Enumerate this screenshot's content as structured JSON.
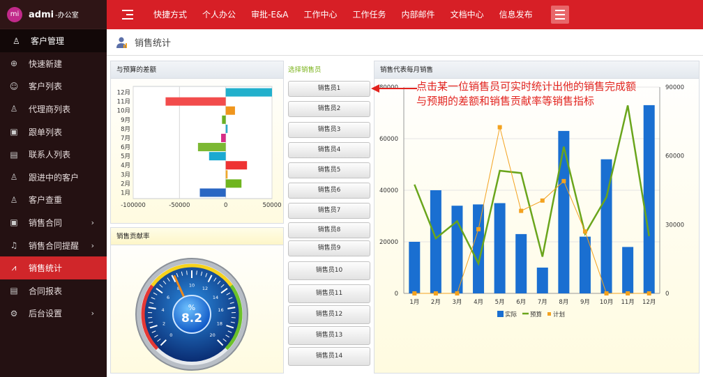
{
  "brand": {
    "avatar": "mi",
    "name": "admi",
    "dept": "-办公室"
  },
  "sidebar": {
    "header": "客户管理",
    "items": [
      {
        "label": "快速新建",
        "icon": "plus-circle-icon",
        "glyph": "⊕",
        "arrow": ""
      },
      {
        "label": "客户列表",
        "icon": "user-icon",
        "glyph": "☺",
        "arrow": ""
      },
      {
        "label": "代理商列表",
        "icon": "users-icon",
        "glyph": "♙",
        "arrow": ""
      },
      {
        "label": "跟单列表",
        "icon": "clipboard-icon",
        "glyph": "▣",
        "arrow": ""
      },
      {
        "label": "联系人列表",
        "icon": "contact-card-icon",
        "glyph": "▤",
        "arrow": ""
      },
      {
        "label": "跟进中的客户",
        "icon": "person-icon",
        "glyph": "♙",
        "arrow": ""
      },
      {
        "label": "客户查重",
        "icon": "person-icon",
        "glyph": "♙",
        "arrow": ""
      },
      {
        "label": "销售合同",
        "icon": "contract-icon",
        "glyph": "▣",
        "arrow": "›"
      },
      {
        "label": "销售合同提醒",
        "icon": "bell-icon",
        "glyph": "♫",
        "arrow": "›"
      },
      {
        "label": "销售统计",
        "icon": "line-chart-icon",
        "glyph": "⩘",
        "arrow": ""
      },
      {
        "label": "合同报表",
        "icon": "report-icon",
        "glyph": "▤",
        "arrow": ""
      },
      {
        "label": "后台设置",
        "icon": "gear-icon",
        "glyph": "⚙",
        "arrow": "›"
      }
    ]
  },
  "topnav": [
    "快捷方式",
    "个人办公",
    "审批-E&A",
    "工作中心",
    "工作任务",
    "内部邮件",
    "文档中心",
    "信息发布"
  ],
  "page": {
    "title": "销售统计"
  },
  "diff_panel": {
    "title": "与预算的差额"
  },
  "rate_panel": {
    "title": "销售贡献率",
    "gauge": {
      "unit": "%",
      "value": "8.2",
      "ticks": [
        "0",
        "2",
        "4",
        "6",
        "8",
        "10",
        "12",
        "14",
        "16",
        "18",
        "20"
      ],
      "pointer": 8.2
    }
  },
  "selector": {
    "title": "选择销售员",
    "buttons": [
      "销售员1",
      "销售员2",
      "销售员3",
      "销售员4",
      "销售员5",
      "销售员6",
      "销售员7",
      "销售员8",
      "销售员9",
      "销售员10",
      "销售员11",
      "销售员12",
      "销售员13",
      "销售员14"
    ]
  },
  "month_panel": {
    "title": "销售代表每月销售"
  },
  "annotation": {
    "line1": "点击某一位销售员可实时统计出他的销售完成额",
    "line2": "与预期的差额和销售贡献率等销售指标"
  },
  "colors": {
    "brand_red": "#d71f26",
    "sidebar_bg": "#241112",
    "bar_blue": "#1a6fd1",
    "line_green": "#6aa51c",
    "line_orange": "#f3a21f"
  },
  "chart_data": [
    {
      "type": "bar",
      "orientation": "horizontal",
      "categories": [
        "1月",
        "2月",
        "3月",
        "4月",
        "5月",
        "6月",
        "7月",
        "8月",
        "9月",
        "10月",
        "11月",
        "12月"
      ],
      "values": [
        -28000,
        17000,
        2000,
        23000,
        -18000,
        -30000,
        -5000,
        2000,
        -4000,
        10000,
        -65000,
        50000
      ],
      "colors": [
        "#2a66c3",
        "#6fb51f",
        "#f0a82a",
        "#ee3333",
        "#1ba9d1",
        "#7cb833",
        "#d62d87",
        "#2da9c9",
        "#6ab023",
        "#f0961d",
        "#f24c4c",
        "#22b0cc"
      ],
      "xticks": [
        "-100000",
        "-50000",
        "0",
        "50000"
      ],
      "xlim": [
        -100000,
        50000
      ],
      "title": "",
      "xlabel": "",
      "ylabel": ""
    },
    {
      "type": "bar",
      "categories": [
        "1月",
        "2月",
        "3月",
        "4月",
        "5月",
        "6月",
        "7月",
        "8月",
        "9月",
        "10月",
        "11月",
        "12月"
      ],
      "series": [
        {
          "name": "实际",
          "type": "bar",
          "axis": "left",
          "values": [
            20000,
            40000,
            34000,
            34500,
            35000,
            23000,
            10000,
            63000,
            22000,
            52000,
            18000,
            73000
          ]
        },
        {
          "name": "预算",
          "type": "line",
          "axis": "right",
          "values": [
            47500,
            24000,
            31500,
            13000,
            53500,
            52500,
            16000,
            64000,
            26000,
            42000,
            82000,
            25000
          ]
        },
        {
          "name": "计划",
          "type": "line",
          "axis": "right",
          "values": [
            0,
            0,
            0,
            28000,
            72500,
            36000,
            40500,
            49000,
            27000,
            0,
            0,
            0
          ]
        }
      ],
      "ylim_left": [
        0,
        80000
      ],
      "yticks_left": [
        "0",
        "20000",
        "40000",
        "60000",
        "80000"
      ],
      "ylim_right": [
        0,
        90000
      ],
      "yticks_right": [
        "0",
        "30000",
        "60000",
        "90000"
      ],
      "legend": "bottom-center",
      "title": "",
      "xlabel": "",
      "ylabel": ""
    }
  ]
}
